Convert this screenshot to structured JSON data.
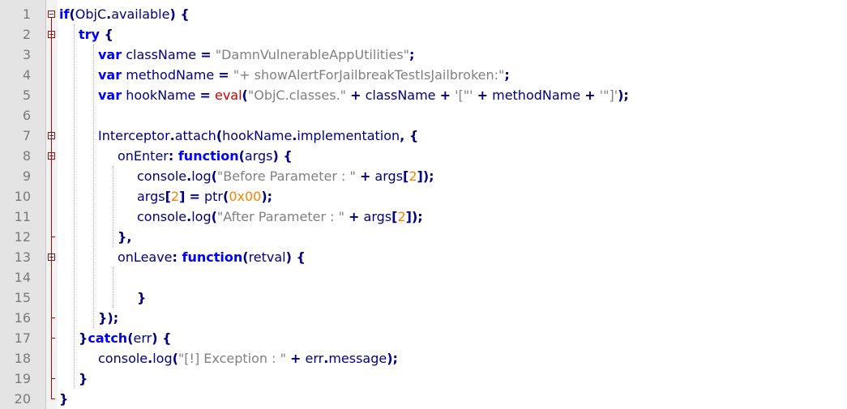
{
  "editor": {
    "lines": [
      {
        "n": "1",
        "indent": 0,
        "tokens": [
          [
            "kw",
            "if"
          ],
          [
            "op",
            "("
          ],
          [
            "id",
            "ObjC"
          ],
          [
            "op",
            "."
          ],
          [
            "id",
            "available"
          ],
          [
            "op",
            ") {"
          ]
        ]
      },
      {
        "n": "2",
        "indent": 1,
        "tokens": [
          [
            "kw",
            "try"
          ],
          [
            "op",
            " {"
          ]
        ]
      },
      {
        "n": "3",
        "indent": 2,
        "tokens": [
          [
            "kw",
            "var"
          ],
          [
            "id",
            " className "
          ],
          [
            "op",
            "="
          ],
          [
            "str",
            " \"DamnVulnerableAppUtilities\""
          ],
          [
            "op",
            ";"
          ]
        ]
      },
      {
        "n": "4",
        "indent": 2,
        "tokens": [
          [
            "kw",
            "var"
          ],
          [
            "id",
            " methodName "
          ],
          [
            "op",
            "="
          ],
          [
            "str",
            " \"+ showAlertForJailbreakTestIsJailbroken:\""
          ],
          [
            "op",
            ";"
          ]
        ]
      },
      {
        "n": "5",
        "indent": 2,
        "tokens": [
          [
            "kw",
            "var"
          ],
          [
            "id",
            " hookName "
          ],
          [
            "op",
            "="
          ],
          [
            "id",
            " "
          ],
          [
            "fn",
            "eval"
          ],
          [
            "op",
            "("
          ],
          [
            "str",
            "\"ObjC.classes.\""
          ],
          [
            "id",
            " "
          ],
          [
            "op",
            "+"
          ],
          [
            "id",
            " className "
          ],
          [
            "op",
            "+"
          ],
          [
            "id",
            " "
          ],
          [
            "str",
            "'[\"'"
          ],
          [
            "id",
            " "
          ],
          [
            "op",
            "+"
          ],
          [
            "id",
            " methodName "
          ],
          [
            "op",
            "+"
          ],
          [
            "id",
            " "
          ],
          [
            "str",
            "'\"]'"
          ],
          [
            "op",
            ");"
          ]
        ]
      },
      {
        "n": "6",
        "indent": 2,
        "tokens": []
      },
      {
        "n": "7",
        "indent": 2,
        "tokens": [
          [
            "id",
            "Interceptor"
          ],
          [
            "op",
            "."
          ],
          [
            "id",
            "attach"
          ],
          [
            "op",
            "("
          ],
          [
            "id",
            "hookName"
          ],
          [
            "op",
            "."
          ],
          [
            "id",
            "implementation"
          ],
          [
            "op",
            ", {"
          ]
        ]
      },
      {
        "n": "8",
        "indent": 3,
        "tokens": [
          [
            "id",
            "onEnter"
          ],
          [
            "op",
            ": "
          ],
          [
            "kw",
            "function"
          ],
          [
            "op",
            "("
          ],
          [
            "id",
            "args"
          ],
          [
            "op",
            ") {"
          ]
        ]
      },
      {
        "n": "9",
        "indent": 4,
        "tokens": [
          [
            "id",
            "console"
          ],
          [
            "op",
            "."
          ],
          [
            "id",
            "log"
          ],
          [
            "op",
            "("
          ],
          [
            "str",
            "\"Before Parameter : \""
          ],
          [
            "id",
            " "
          ],
          [
            "op",
            "+"
          ],
          [
            "id",
            " args"
          ],
          [
            "op",
            "["
          ],
          [
            "num",
            "2"
          ],
          [
            "op",
            "]);"
          ]
        ]
      },
      {
        "n": "10",
        "indent": 4,
        "tokens": [
          [
            "id",
            "args"
          ],
          [
            "op",
            "["
          ],
          [
            "num",
            "2"
          ],
          [
            "op",
            "]"
          ],
          [
            "id",
            " "
          ],
          [
            "op",
            "="
          ],
          [
            "id",
            " ptr"
          ],
          [
            "op",
            "("
          ],
          [
            "num",
            "0x00"
          ],
          [
            "op",
            ");"
          ]
        ]
      },
      {
        "n": "11",
        "indent": 4,
        "tokens": [
          [
            "id",
            "console"
          ],
          [
            "op",
            "."
          ],
          [
            "id",
            "log"
          ],
          [
            "op",
            "("
          ],
          [
            "str",
            "\"After Parameter : \""
          ],
          [
            "id",
            " "
          ],
          [
            "op",
            "+"
          ],
          [
            "id",
            " args"
          ],
          [
            "op",
            "["
          ],
          [
            "num",
            "2"
          ],
          [
            "op",
            "]);"
          ]
        ]
      },
      {
        "n": "12",
        "indent": 3,
        "tokens": [
          [
            "op",
            "},"
          ]
        ]
      },
      {
        "n": "13",
        "indent": 3,
        "tokens": [
          [
            "id",
            "onLeave"
          ],
          [
            "op",
            ": "
          ],
          [
            "kw",
            "function"
          ],
          [
            "op",
            "("
          ],
          [
            "id",
            "retval"
          ],
          [
            "op",
            ") {"
          ]
        ]
      },
      {
        "n": "14",
        "indent": 3,
        "tokens": []
      },
      {
        "n": "15",
        "indent": 4,
        "tokens": [
          [
            "op",
            "}"
          ]
        ]
      },
      {
        "n": "16",
        "indent": 2,
        "tokens": [
          [
            "op",
            "});"
          ]
        ]
      },
      {
        "n": "17",
        "indent": 1,
        "tokens": [
          [
            "op",
            "}"
          ],
          [
            "kw",
            "catch"
          ],
          [
            "op",
            "("
          ],
          [
            "id",
            "err"
          ],
          [
            "op",
            ") {"
          ]
        ]
      },
      {
        "n": "18",
        "indent": 2,
        "tokens": [
          [
            "id",
            "console"
          ],
          [
            "op",
            "."
          ],
          [
            "id",
            "log"
          ],
          [
            "op",
            "("
          ],
          [
            "str",
            "\"[!] Exception : \""
          ],
          [
            "id",
            " "
          ],
          [
            "op",
            "+"
          ],
          [
            "id",
            " err"
          ],
          [
            "op",
            "."
          ],
          [
            "id",
            "message"
          ],
          [
            "op",
            ");"
          ]
        ]
      },
      {
        "n": "19",
        "indent": 1,
        "tokens": [
          [
            "op",
            "}"
          ]
        ]
      },
      {
        "n": "20",
        "indent": 0,
        "tokens": [
          [
            "op",
            "}"
          ]
        ]
      }
    ]
  }
}
